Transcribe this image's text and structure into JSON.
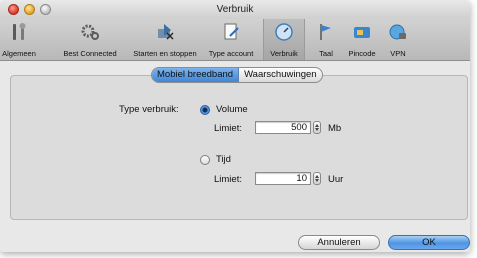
{
  "window": {
    "title": "Verbruik"
  },
  "toolbar": {
    "items": [
      {
        "label": "Algemeen",
        "icon": "tools-icon"
      },
      {
        "label": "Best Connected",
        "icon": "gears-icon"
      },
      {
        "label": "Starten en stoppen",
        "icon": "start-stop-icon"
      },
      {
        "label": "Type account",
        "icon": "document-pen-icon"
      },
      {
        "label": "Verbruik",
        "icon": "gauge-icon",
        "active": true
      },
      {
        "label": "Taal",
        "icon": "flag-icon"
      },
      {
        "label": "Pincode",
        "icon": "sim-card-icon"
      },
      {
        "label": "VPN",
        "icon": "globe-lock-icon"
      }
    ]
  },
  "tabs": {
    "mobile": "Mobiel breedband",
    "warnings": "Waarschuwingen",
    "selected": "Mobiel breedband"
  },
  "form": {
    "type_label": "Type verbruik:",
    "volume": {
      "label": "Volume",
      "selected": true,
      "limit_label": "Limiet:",
      "value": "500",
      "unit": "Mb"
    },
    "time": {
      "label": "Tijd",
      "selected": false,
      "limit_label": "Limiet:",
      "value": "10",
      "unit": "Uur"
    }
  },
  "buttons": {
    "cancel": "Annuleren",
    "ok": "OK"
  },
  "colors": {
    "accent": "#4f95e3",
    "selected_tab": "#3f86d8"
  }
}
